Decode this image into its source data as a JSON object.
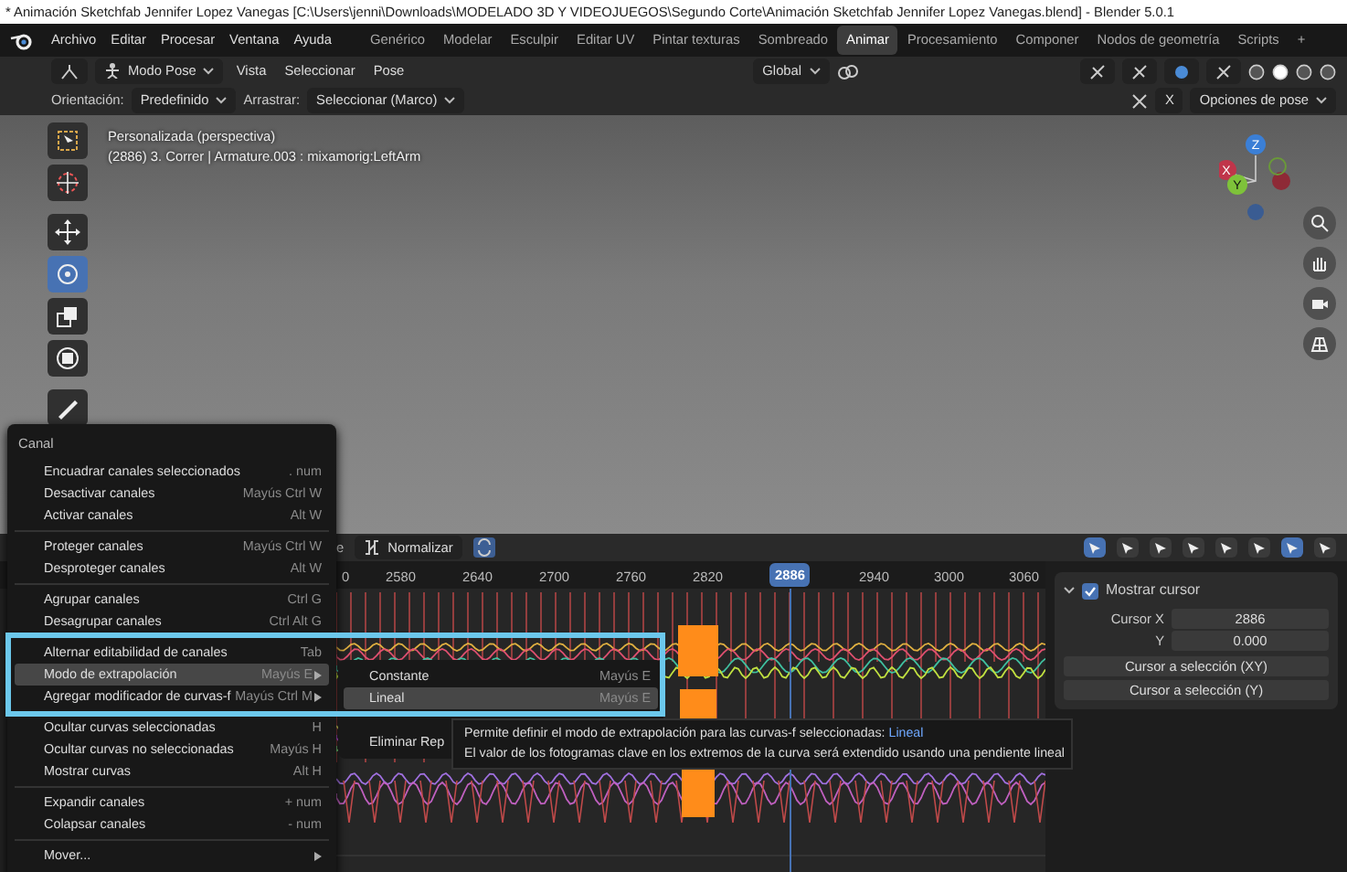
{
  "window": {
    "title": "* Animación Sketchfab Jennifer Lopez Vanegas [C:\\Users\\jenni\\Downloads\\MODELADO 3D Y VIDEOJUEGOS\\Segundo Corte\\Animación Sketchfab Jennifer Lopez Vanegas.blend] - Blender 5.0.1"
  },
  "menubar": {
    "menus": [
      "Archivo",
      "Editar",
      "Procesar",
      "Ventana",
      "Ayuda"
    ],
    "workspaces": [
      {
        "label": "Genérico",
        "selected": false
      },
      {
        "label": "Modelar",
        "selected": false
      },
      {
        "label": "Esculpir",
        "selected": false
      },
      {
        "label": "Editar UV",
        "selected": false
      },
      {
        "label": "Pintar texturas",
        "selected": false
      },
      {
        "label": "Sombreado",
        "selected": false
      },
      {
        "label": "Animar",
        "selected": true
      },
      {
        "label": "Procesamiento",
        "selected": false
      },
      {
        "label": "Componer",
        "selected": false
      },
      {
        "label": "Nodos de geometría",
        "selected": false
      },
      {
        "label": "Scripts",
        "selected": false
      }
    ],
    "add_workspace": "+"
  },
  "viewport": {
    "header": {
      "mode": "Modo Pose",
      "menus": [
        "Vista",
        "Seleccionar",
        "Pose"
      ],
      "transform": "Global"
    },
    "tool_header": {
      "orientation_label": "Orientación:",
      "orientation": "Predefinido",
      "drag_label": "Arrastrar:",
      "drag": "Seleccionar (Marco)",
      "mirror": "X",
      "pose_options": "Opciones de pose"
    },
    "overlay": [
      "Personalizada (perspectiva)",
      "(2886) 3. Correr | Armature.003 : mixamorig:LeftArm"
    ],
    "tools": [
      {
        "kind": "select",
        "selected": false
      },
      {
        "kind": "cursor",
        "selected": false
      },
      {
        "kind": "move",
        "selected": false
      },
      {
        "kind": "rotate",
        "selected": true
      },
      {
        "kind": "scale",
        "selected": false
      },
      {
        "kind": "transform",
        "selected": false
      },
      {
        "kind": "annotate",
        "selected": false
      }
    ],
    "gizmo": {
      "axes": [
        "Z",
        "X",
        "Y"
      ]
    }
  },
  "graph_editor": {
    "header_cut": "e",
    "normalize": {
      "label": "Normalizar",
      "on": false
    },
    "ruler": [
      "0",
      "2580",
      "2640",
      "2700",
      "2760",
      "2820",
      "2940",
      "3000",
      "3060"
    ],
    "current_frame": "2886",
    "sidebar": {
      "show_cursor": {
        "label": "Mostrar cursor",
        "checked": true
      },
      "fields": [
        {
          "label": "Cursor X",
          "value": "2886"
        },
        {
          "label": "Y",
          "value": "0.000"
        }
      ],
      "buttons": [
        "Cursor a selección (XY)",
        "Cursor a selección (Y)"
      ]
    }
  },
  "menu": {
    "title": "Canal",
    "items": [
      {
        "kind": "item",
        "label": "Encuadrar canales seleccionados",
        "shortcut": ". num",
        "selected": false,
        "submenu": false
      },
      {
        "kind": "item",
        "label": "Desactivar canales",
        "shortcut": "Mayús Ctrl W",
        "selected": false,
        "submenu": false
      },
      {
        "kind": "item",
        "label": "Activar canales",
        "shortcut": "Alt W",
        "selected": false,
        "submenu": false
      },
      {
        "kind": "separator"
      },
      {
        "kind": "item",
        "label": "Proteger canales",
        "shortcut": "Mayús Ctrl W",
        "selected": false,
        "submenu": false
      },
      {
        "kind": "item",
        "label": "Desproteger canales",
        "shortcut": "Alt W",
        "selected": false,
        "submenu": false
      },
      {
        "kind": "separator"
      },
      {
        "kind": "item",
        "label": "Agrupar canales",
        "shortcut": "Ctrl G",
        "selected": false,
        "submenu": false
      },
      {
        "kind": "item",
        "label": "Desagrupar canales",
        "shortcut": "Ctrl Alt G",
        "selected": false,
        "submenu": false
      },
      {
        "kind": "separator"
      },
      {
        "kind": "item",
        "label": "Alternar editabilidad de canales",
        "shortcut": "Tab",
        "selected": false,
        "submenu": false
      },
      {
        "kind": "item",
        "label": "Modo de extrapolación",
        "shortcut": "Mayús E",
        "selected": true,
        "submenu": true
      },
      {
        "kind": "item",
        "label": "Agregar modificador de curvas-f",
        "shortcut": "Mayús Ctrl M",
        "selected": false,
        "submenu": true
      },
      {
        "kind": "separator"
      },
      {
        "kind": "item",
        "label": "Ocultar curvas seleccionadas",
        "shortcut": "H",
        "selected": false,
        "submenu": false
      },
      {
        "kind": "item",
        "label": "Ocultar curvas no seleccionadas",
        "shortcut": "Mayús H",
        "selected": false,
        "submenu": false
      },
      {
        "kind": "item",
        "label": "Mostrar curvas",
        "shortcut": "Alt H",
        "selected": false,
        "submenu": false
      },
      {
        "kind": "separator"
      },
      {
        "kind": "item",
        "label": "Expandir canales",
        "shortcut": "+ num",
        "selected": false,
        "submenu": false
      },
      {
        "kind": "item",
        "label": "Colapsar canales",
        "shortcut": "- num",
        "selected": false,
        "submenu": false
      },
      {
        "kind": "separator"
      },
      {
        "kind": "item",
        "label": "Mover...",
        "selected": false,
        "submenu": true
      }
    ]
  },
  "submenu": {
    "items": [
      {
        "kind": "item",
        "label": "Constante",
        "shortcut": "Mayús E",
        "selected": false
      },
      {
        "kind": "item",
        "label": "Lineal",
        "shortcut": "Mayús E",
        "selected": true
      },
      {
        "kind": "covered"
      },
      {
        "kind": "item",
        "label": "Eliminar Rep",
        "selected": false
      }
    ]
  },
  "tooltip": {
    "text": "Permite definir el modo de extrapolación para las curvas-f seleccionadas:",
    "value": "Lineal",
    "detail": "El valor de los fotogramas clave en los extremos de la curva será extendido usando una pendiente lineal"
  }
}
